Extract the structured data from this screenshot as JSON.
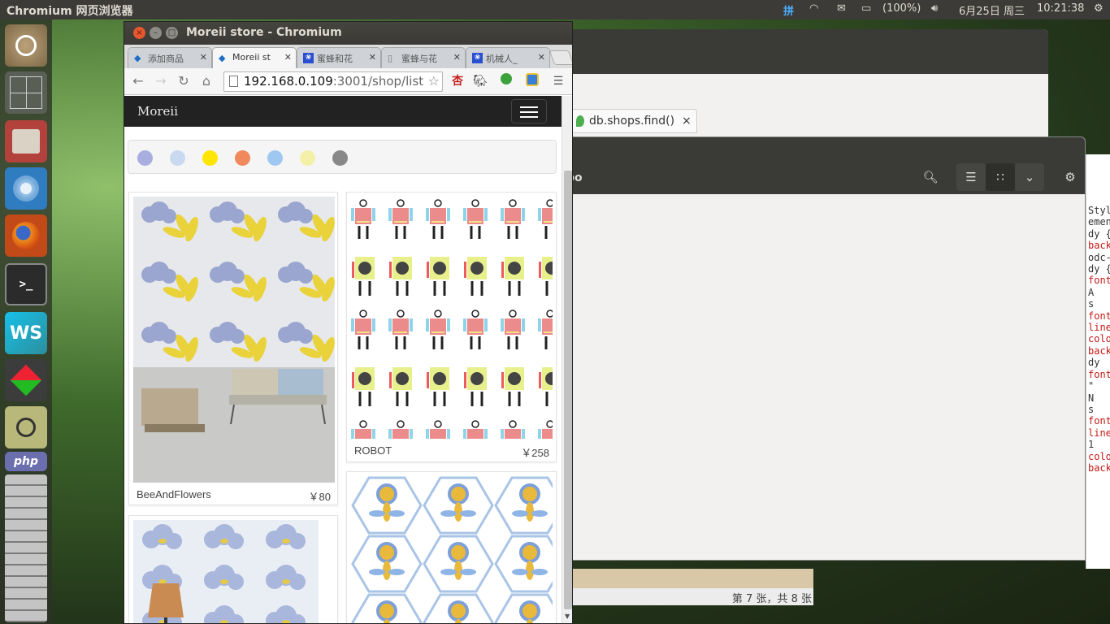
{
  "top_panel": {
    "app_title": "Chromium 网页浏览器",
    "input_method": "拼",
    "battery": "(100%)",
    "date": "6月25日 周三",
    "time": "10:21:38"
  },
  "launcher": {
    "items": [
      {
        "name": "ubuntu-dash-icon"
      },
      {
        "name": "workspace-switcher-icon"
      },
      {
        "name": "files-icon"
      },
      {
        "name": "chromium-launcher-icon"
      },
      {
        "name": "firefox-icon"
      },
      {
        "name": "terminal-icon"
      },
      {
        "name": "webstorm-icon"
      },
      {
        "name": "cube-app-icon"
      },
      {
        "name": "image-viewer-icon"
      },
      {
        "name": "php-arduino-icon"
      }
    ]
  },
  "background": {
    "mongo_tab_label": "db.shops.find()",
    "mongo_tab_close": "×",
    "files_partial_label": "bo",
    "image_viewer_status": "第 7 张，共 8 张",
    "devtools_lines": [
      "Styles",
      "ement",
      "dy {",
      "back",
      "odc-",
      "dy {",
      "font",
      "A",
      "s",
      "font",
      "line",
      "colo",
      "back",
      "dy",
      "font",
      "\"",
      "N",
      "s",
      "font",
      "line",
      "1",
      "colo",
      "back"
    ]
  },
  "chromium": {
    "window_title": "Moreii store - Chromium",
    "tabs": [
      {
        "label": "添加商品",
        "favicon": "diamond-icon"
      },
      {
        "label": "Moreii st",
        "favicon": "diamond-icon"
      },
      {
        "label": "蜜蜂和花",
        "favicon": "baidu-paw-icon"
      },
      {
        "label": "蜜蜂与花",
        "favicon": "document-icon"
      },
      {
        "label": "机械人_",
        "favicon": "baidu-paw-icon"
      }
    ],
    "url_host": "192.168.0.109",
    "url_rest": ":3001/shop/list",
    "extension_glyph": "杏"
  },
  "page": {
    "brand": "Moreii",
    "filter_colors": [
      "#a9aee0",
      "#c8d9f0",
      "#ffe600",
      "#f08a5d",
      "#9ec8f0",
      "#f4f0a8",
      "#888888"
    ],
    "products": [
      {
        "name": "BeeAndFlowers",
        "price": "￥80"
      },
      {
        "name": "ROBOT",
        "price": "￥258"
      },
      {
        "name": "",
        "price": ""
      },
      {
        "name": "",
        "price": ""
      }
    ]
  },
  "colors": {
    "panel": "#3c3b37",
    "navbar": "#222222",
    "accent_link": "#1e6fc4"
  }
}
